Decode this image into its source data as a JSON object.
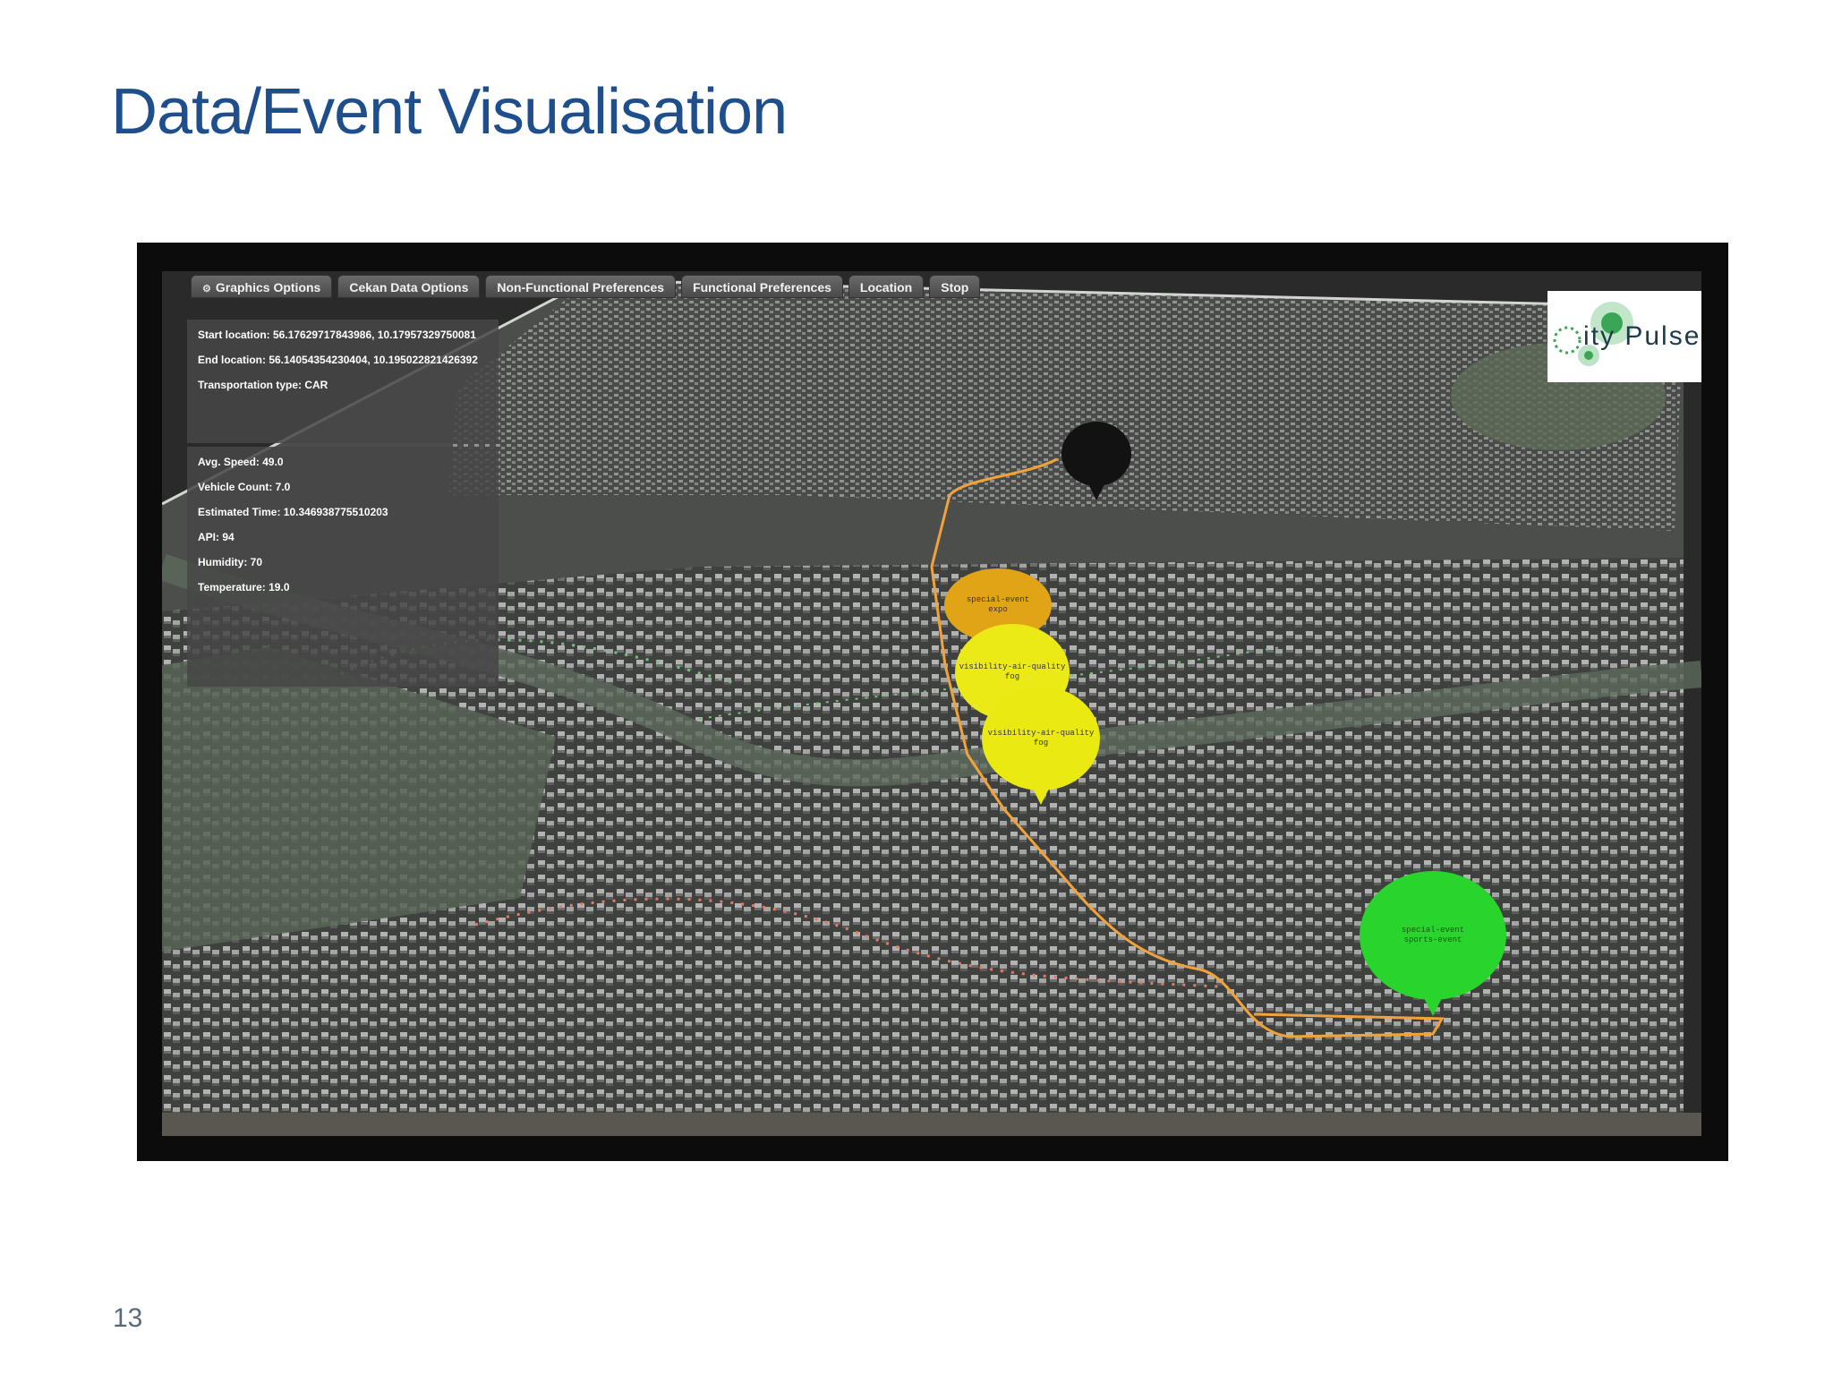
{
  "slide": {
    "title": "Data/Event Visualisation",
    "page_number": "13"
  },
  "toolbar": {
    "tabs": [
      {
        "label": "Graphics Options",
        "icon": "gear-icon"
      },
      {
        "label": "Cekan Data Options"
      },
      {
        "label": "Non-Functional Preferences"
      },
      {
        "label": "Functional Preferences"
      },
      {
        "label": "Location"
      },
      {
        "label": "Stop"
      }
    ]
  },
  "route_panel": {
    "start": "Start location: 56.17629717843986, 10.17957329750081",
    "end": "End location: 56.14054354230404, 10.195022821426392",
    "transport": "Transportation type: CAR"
  },
  "stats_panel": {
    "avg_speed": "Avg. Speed: 49.0",
    "vehicle_count": "Vehicle Count: 7.0",
    "estimated_time": "Estimated Time: 10.346938775510203",
    "api": "API: 94",
    "humidity": "Humidity: 70",
    "temperature": "Temperature: 19.0"
  },
  "logo": {
    "text": "ity Pulse",
    "accent_color": "#3aa655"
  },
  "markers": {
    "black": {
      "color": "#121212"
    },
    "orange": {
      "line1": "special-event",
      "line2": "expo",
      "color": "#e0a416"
    },
    "yellow1": {
      "line1": "visibility-air-quality",
      "line2": "fog",
      "color": "#ecea16"
    },
    "yellow2": {
      "line1": "visibility-air-quality",
      "line2": "fog",
      "color": "#eaea12"
    },
    "green": {
      "line1": "special-event",
      "line2": "sports-event",
      "color": "#29d42d"
    }
  },
  "colors": {
    "title": "#1f4e8c",
    "route": "#f2a23a",
    "map_ground": "#3b3d3b"
  }
}
